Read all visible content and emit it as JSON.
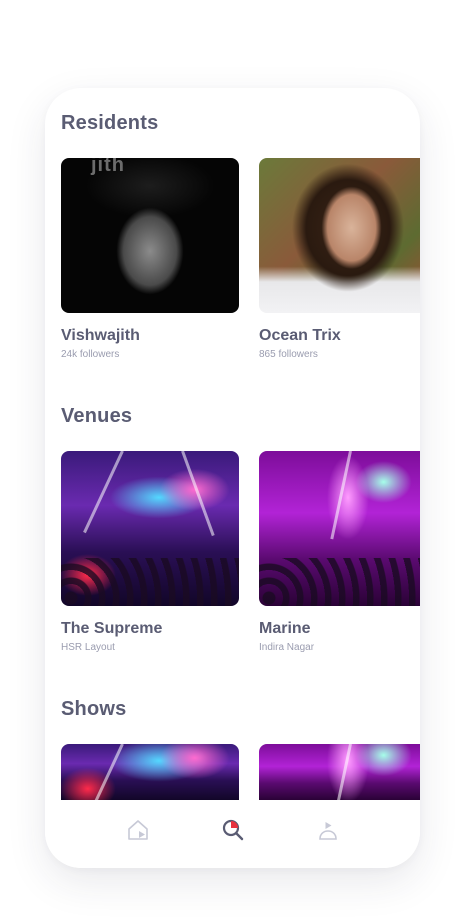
{
  "sections": {
    "residents": {
      "title": "Residents",
      "items": [
        {
          "name": "Vishwajith",
          "sub": "24k followers",
          "photo_text": "jith"
        },
        {
          "name": "Ocean Trix",
          "sub": "865 followers"
        }
      ]
    },
    "venues": {
      "title": "Venues",
      "items": [
        {
          "name": "The Supreme",
          "sub": "HSR Layout"
        },
        {
          "name": "Marine",
          "sub": "Indira Nagar"
        }
      ]
    },
    "shows": {
      "title": "Shows"
    }
  },
  "tabbar": {
    "tabs": [
      {
        "icon": "home-icon",
        "active": false
      },
      {
        "icon": "search-icon",
        "active": true
      },
      {
        "icon": "profile-icon",
        "active": false
      }
    ]
  },
  "colors": {
    "heading": "#5a5c73",
    "subtext": "#9a9caf",
    "accent": "#e8323f",
    "icon_inactive": "#c7c9d6"
  }
}
